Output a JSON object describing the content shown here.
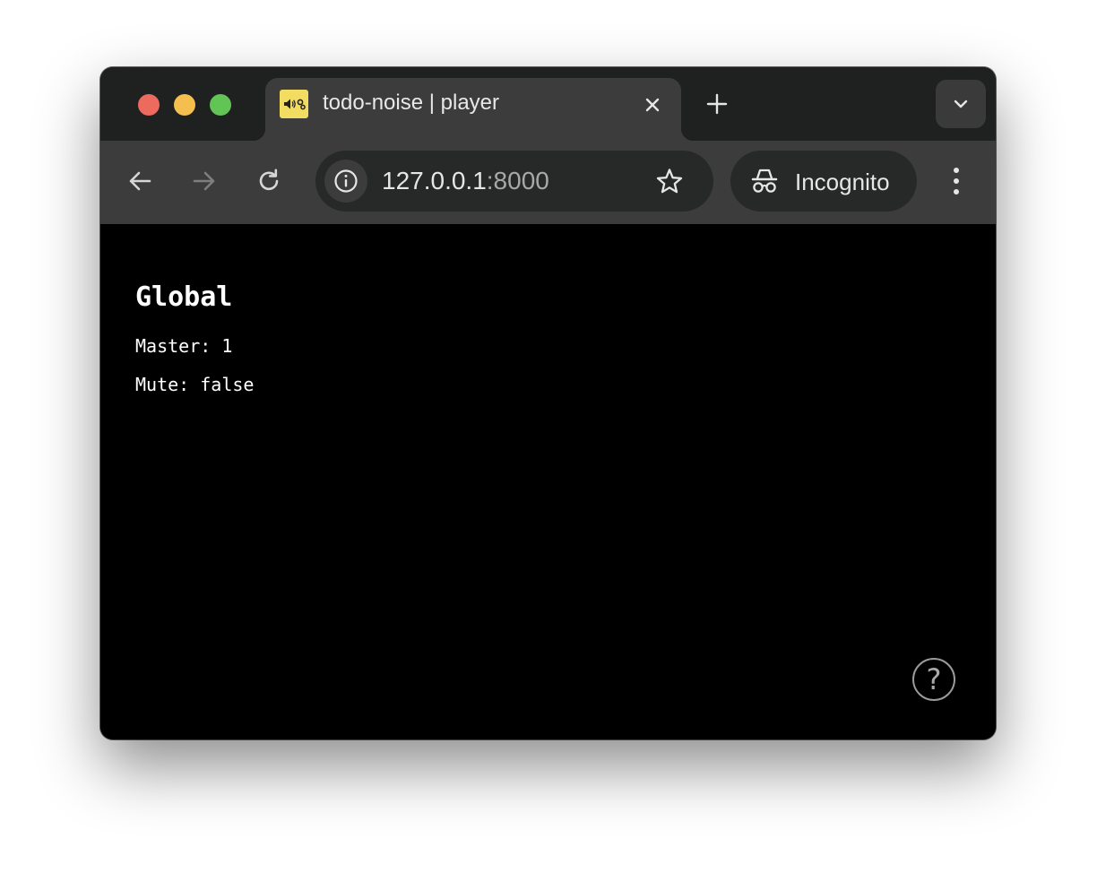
{
  "tab": {
    "title": "todo-noise | player",
    "favicon": "speaker-gear-icon",
    "favicon_color": "#f2dd62"
  },
  "toolbar": {
    "url_host": "127.0.0.1",
    "url_port": ":8000",
    "profile_label": "Incognito"
  },
  "page": {
    "heading": "Global",
    "master_line": "Master: 1",
    "mute_line": "Mute: false",
    "help_symbol": "?"
  },
  "colors": {
    "traffic_red": "#ed6a5e",
    "traffic_yellow": "#f5bf4f",
    "traffic_green": "#61c454",
    "page_background": "#000000"
  }
}
